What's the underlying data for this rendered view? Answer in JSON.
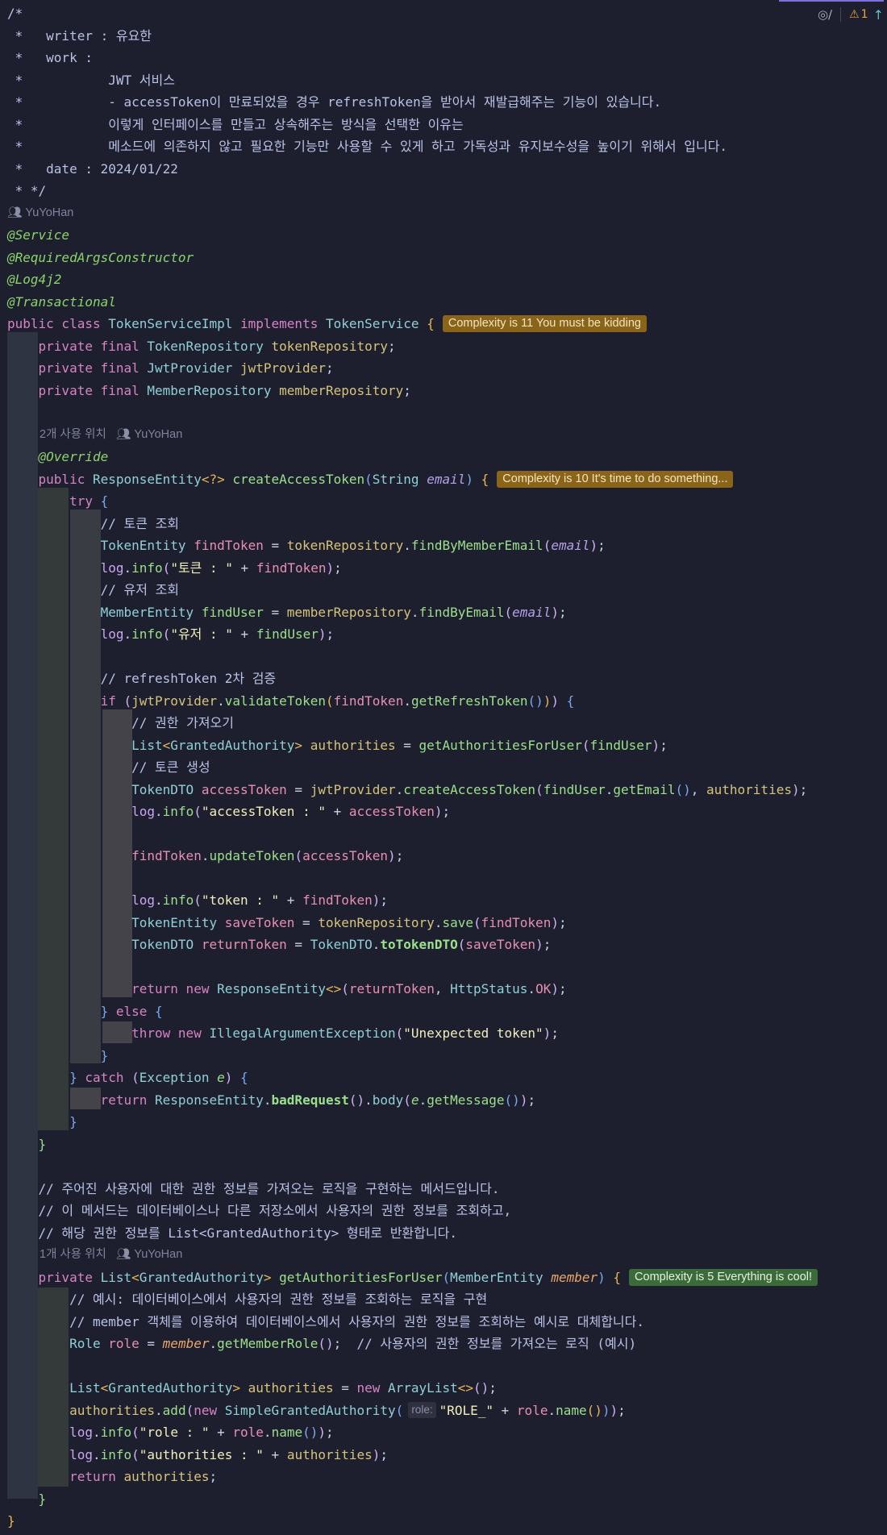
{
  "toolbar": {
    "reader_mode_icon": "eye-slash-icon",
    "warning_count": "1",
    "warning_icon": "warning-triangle-icon",
    "scroll_up_icon": "arrow-up-icon"
  },
  "header_comment": {
    "open": "/*",
    "writer": " *   writer : 유요한",
    "work": " *   work :",
    "work1": " *           JWT 서비스",
    "work2": " *           - accessToken이 만료되었을 경우 refreshToken을 받아서 재발급해주는 기능이 있습니다.",
    "work3": " *           이렇게 인터페이스를 만들고 상속해주는 방식을 선택한 이유는",
    "work4": " *           메소드에 의존하지 않고 필요한 기능만 사용할 수 있게 하고 가독성과 유지보수성을 높이기 위해서 입니다.",
    "date": " *   date : 2024/01/22",
    "close": " * */"
  },
  "authors": {
    "class_author": "YuYoHan",
    "m1_usage": "2개 사용 위치",
    "m1_author": "YuYoHan",
    "m2_usage": "1개 사용 위치",
    "m2_author": "YuYoHan"
  },
  "annotations": [
    "@Service",
    "@RequiredArgsConstructor",
    "@Log4j2",
    "@Transactional"
  ],
  "badges": {
    "class_complexity": "Complexity is 11 You must be kidding",
    "m1_complexity": "Complexity is 10 It's time to do something...",
    "m2_complexity": "Complexity is 5 Everything is cool!"
  },
  "inlay": {
    "role_param": "role:"
  },
  "strings": {
    "token_log": "\"토큰 : \"",
    "user_log": "\"유저 : \"",
    "access_log": "\"accessToken : \"",
    "token2_log": "\"token : \"",
    "unexpected": "\"Unexpected token\"",
    "role_prefix": "\"ROLE_\"",
    "role_log": "\"role : \"",
    "auth_log": "\"authorities : \""
  },
  "comments": {
    "c_token_lookup": "// 토큰 조회",
    "c_user_lookup": "// 유저 조회",
    "c_refresh_verify": "// refreshToken 2차 검증",
    "c_get_authority": "// 권한 가져오기",
    "c_create_token": "// 토큰 생성",
    "c_doc1": "// 주어진 사용자에 대한 권한 정보를 가져오는 로직을 구현하는 메서드입니다.",
    "c_doc2": "// 이 메서드는 데이터베이스나 다른 저장소에서 사용자의 권한 정보를 조회하고,",
    "c_doc3": "// 해당 권한 정보를 List<GrantedAuthority> 형태로 반환합니다.",
    "c_ex1": "// 예시: 데이터베이스에서 사용자의 권한 정보를 조회하는 로직을 구현",
    "c_ex2": "// member 객체를 이용하여 데이터베이스에서 사용자의 권한 정보를 조회하는 예시로 대체합니다.",
    "c_role_trail": "// 사용자의 권한 정보를 가져오는 로직 (예시)"
  }
}
